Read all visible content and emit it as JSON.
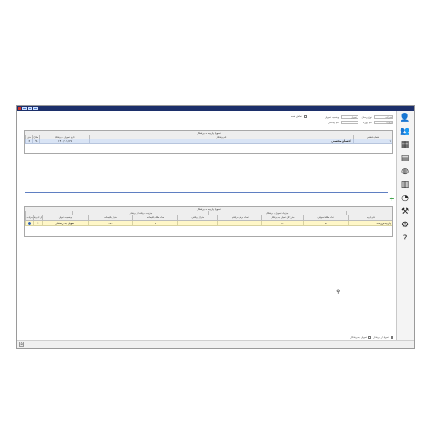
{
  "filters": {
    "person_type_label": "نوع پرسنل",
    "person_type_value": "شرکت",
    "project_label": "نام پروژه",
    "project_value": "پروژه",
    "status_label": "وضعیت تحویل",
    "status_value": "تحویل",
    "contractor_label": "نام پیمانکار",
    "show_all_label": "نمایش همه"
  },
  "top_grid": {
    "band_title": "تحویل پارچه به برشکار",
    "columns": [
      "شماره قطعی",
      "نام برشکار",
      "تاریخ تحویل به برشکار",
      "اصلاح",
      "حذف"
    ],
    "rows": [
      {
        "num": "۱",
        "name": "احسان محسنی",
        "date": "۱۴۰۲/۰۱/۱۷"
      }
    ]
  },
  "bottom_grid": {
    "band_title": "تحویل پارچه به برشکار",
    "group_delivery": "جزئیات تحویل به برشکار",
    "group_receive": "جزئیات دریافت از برشکار",
    "columns": [
      "نام پارچه",
      "تعداد طاقه تحویلی",
      "متراژ کل تحویل به برشکار",
      "تعداد برش دریافتی",
      "متراژ دریافتی",
      "تعداد طاقه باقیمانده",
      "متراژ باقیمانده",
      "وضعیت تحویل",
      "تحویل از برشکار",
      "جزئیات"
    ],
    "rows": [
      {
        "fabric": "پارچه برزنت",
        "rolls": "۵",
        "total_meter": "۱۵۰",
        "cut_count": "",
        "received_meter": "۰",
        "remaining_rolls": "۵",
        "remaining_meter": "۱۵۰",
        "status": "تحویل به برشکار"
      }
    ]
  },
  "status_bar": {
    "option1": "تحویل از برشکار",
    "option2": "تحویل به برشکار"
  }
}
